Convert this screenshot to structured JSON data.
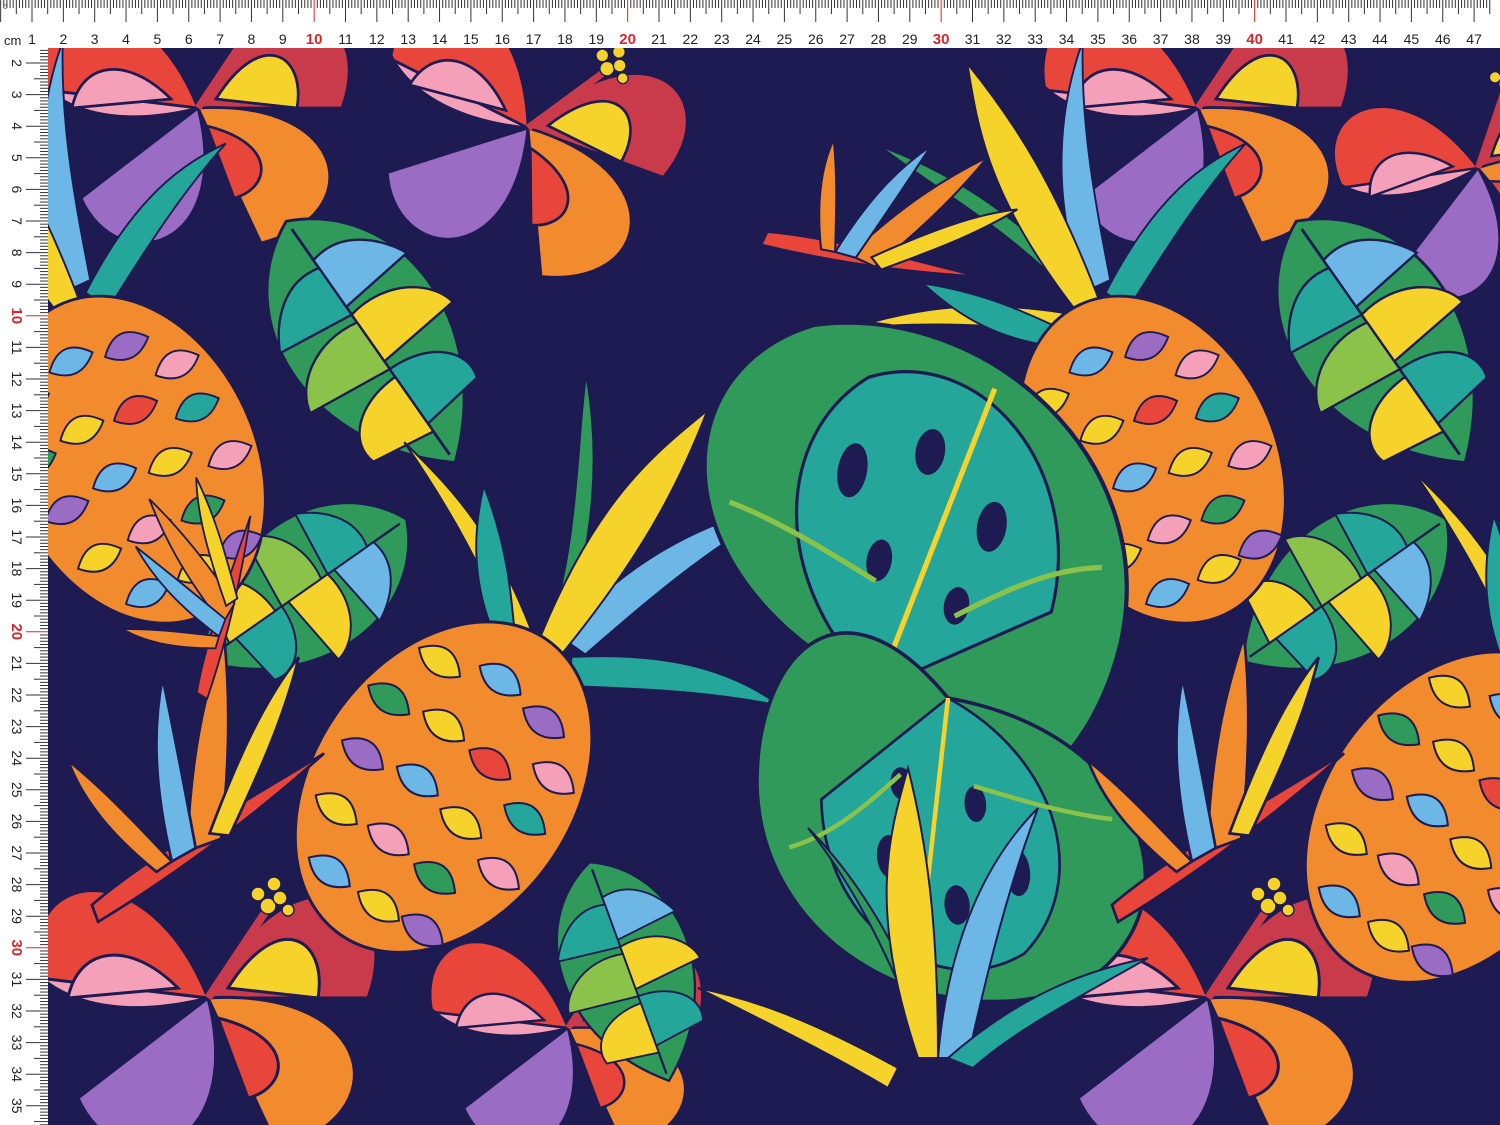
{
  "ruler": {
    "unit_label": "cm",
    "corner_mark": "o",
    "top_numbers": [
      "1",
      "2",
      "3",
      "4",
      "5",
      "6",
      "7",
      "8",
      "9",
      "10",
      "11",
      "12",
      "13",
      "14",
      "15",
      "16",
      "17",
      "18",
      "19",
      "20",
      "21",
      "22",
      "23",
      "24",
      "25",
      "26",
      "27",
      "28",
      "29",
      "30",
      "31",
      "32",
      "33",
      "34",
      "35",
      "36",
      "37",
      "38",
      "39",
      "40",
      "41",
      "42",
      "43",
      "44",
      "45",
      "46",
      "47"
    ],
    "left_numbers": [
      "2",
      "3",
      "4",
      "5",
      "6",
      "7",
      "8",
      "9",
      "10",
      "11",
      "12",
      "13",
      "14",
      "15",
      "16",
      "17",
      "18",
      "19",
      "20",
      "21",
      "22",
      "23",
      "24",
      "25",
      "26",
      "27",
      "28",
      "29",
      "30",
      "31",
      "32",
      "33",
      "34",
      "35"
    ],
    "highlight_numbers": [
      "10",
      "20",
      "30",
      "40"
    ],
    "colors": {
      "normal": "#222222",
      "highlight": "#d8262c",
      "tick": "#333333"
    }
  },
  "fabric": {
    "background": "#1d1b52",
    "motifs": [
      "hibiscus-flower",
      "pineapple",
      "monstera-leaf",
      "bird-of-paradise-flower",
      "tropical-leaf"
    ],
    "palette": [
      "#1d1b52",
      "#e8463a",
      "#f28a2e",
      "#f6d32a",
      "#2f9a5a",
      "#24a79a",
      "#6cb7e6",
      "#9b6cc3",
      "#f3a0b8",
      "#c93a4b"
    ]
  }
}
